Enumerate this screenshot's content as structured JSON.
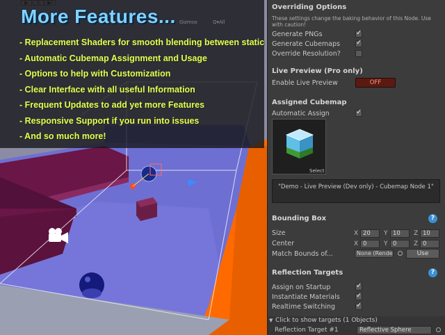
{
  "scene": {
    "toolbar_buttons": [
      "▶",
      "II",
      "▶I"
    ],
    "gizmos_label": "Gizmos",
    "search_label": "Q▾All",
    "promo": {
      "title": "More Features...",
      "items": [
        "- Replacement Shaders for smooth blending between static cubemaps",
        "- Automatic Cubemap Assignment and Usage",
        "- Options to help with Customization",
        "- Clear Interface with all useful Information",
        "- Frequent Updates to add yet more Features",
        "- Responsive Support if you run into issues",
        "- And so much more!"
      ]
    },
    "icons": [
      "camera-icon"
    ]
  },
  "inspector": {
    "overriding": {
      "title": "Overriding Options",
      "note": "These settings change the baking behavior of this Node. Use with caution!",
      "generate_pngs": {
        "label": "Generate PNGs",
        "checked": true
      },
      "generate_cubemaps": {
        "label": "Generate Cubemaps",
        "checked": true
      },
      "override_resolution": {
        "label": "Override Resolution?",
        "checked": false
      }
    },
    "live_preview": {
      "title": "Live Preview (Pro only)",
      "enable_label": "Enable Live Preview",
      "toggle_value": "OFF",
      "toggle_color": "#5a1a12"
    },
    "assigned_cubemap": {
      "title": "Assigned Cubemap",
      "auto_assign": {
        "label": "Automatic Assign",
        "checked": true
      },
      "select_label": "Select",
      "description": "\"Demo - Live Preview (Dev only) - Cubemap Node 1\""
    },
    "bounding_box": {
      "title": "Bounding Box",
      "size_label": "Size",
      "center_label": "Center",
      "size": {
        "x": "20",
        "y": "10",
        "z": "10"
      },
      "center": {
        "x": "0",
        "y": "0",
        "z": "0"
      },
      "axis_labels": [
        "X",
        "Y",
        "Z"
      ],
      "match_label": "Match Bounds of...",
      "match_dropdown": "None (Rende",
      "use_button": "Use"
    },
    "reflection_targets": {
      "title": "Reflection Targets",
      "assign_on_startup": {
        "label": "Assign on Startup",
        "checked": true
      },
      "instantiate_materials": {
        "label": "Instantiate Materials",
        "checked": true
      },
      "realtime_switching": {
        "label": "Realtime Switching",
        "checked": true
      },
      "foldout_label": "Click to show targets (1 Objects)",
      "target_label": "Reflection Target #1",
      "target_value": "Reflective Sphere"
    },
    "help_icon": "help-icon"
  },
  "colors": {
    "promo_title": "#7fd3ff",
    "promo_items": "#e3ff4f",
    "floor": "#6c6ccf",
    "orange_wall": "#ff6a00",
    "inspector_bg": "#3c3c3c",
    "help_blue": "#3d8fd6"
  }
}
